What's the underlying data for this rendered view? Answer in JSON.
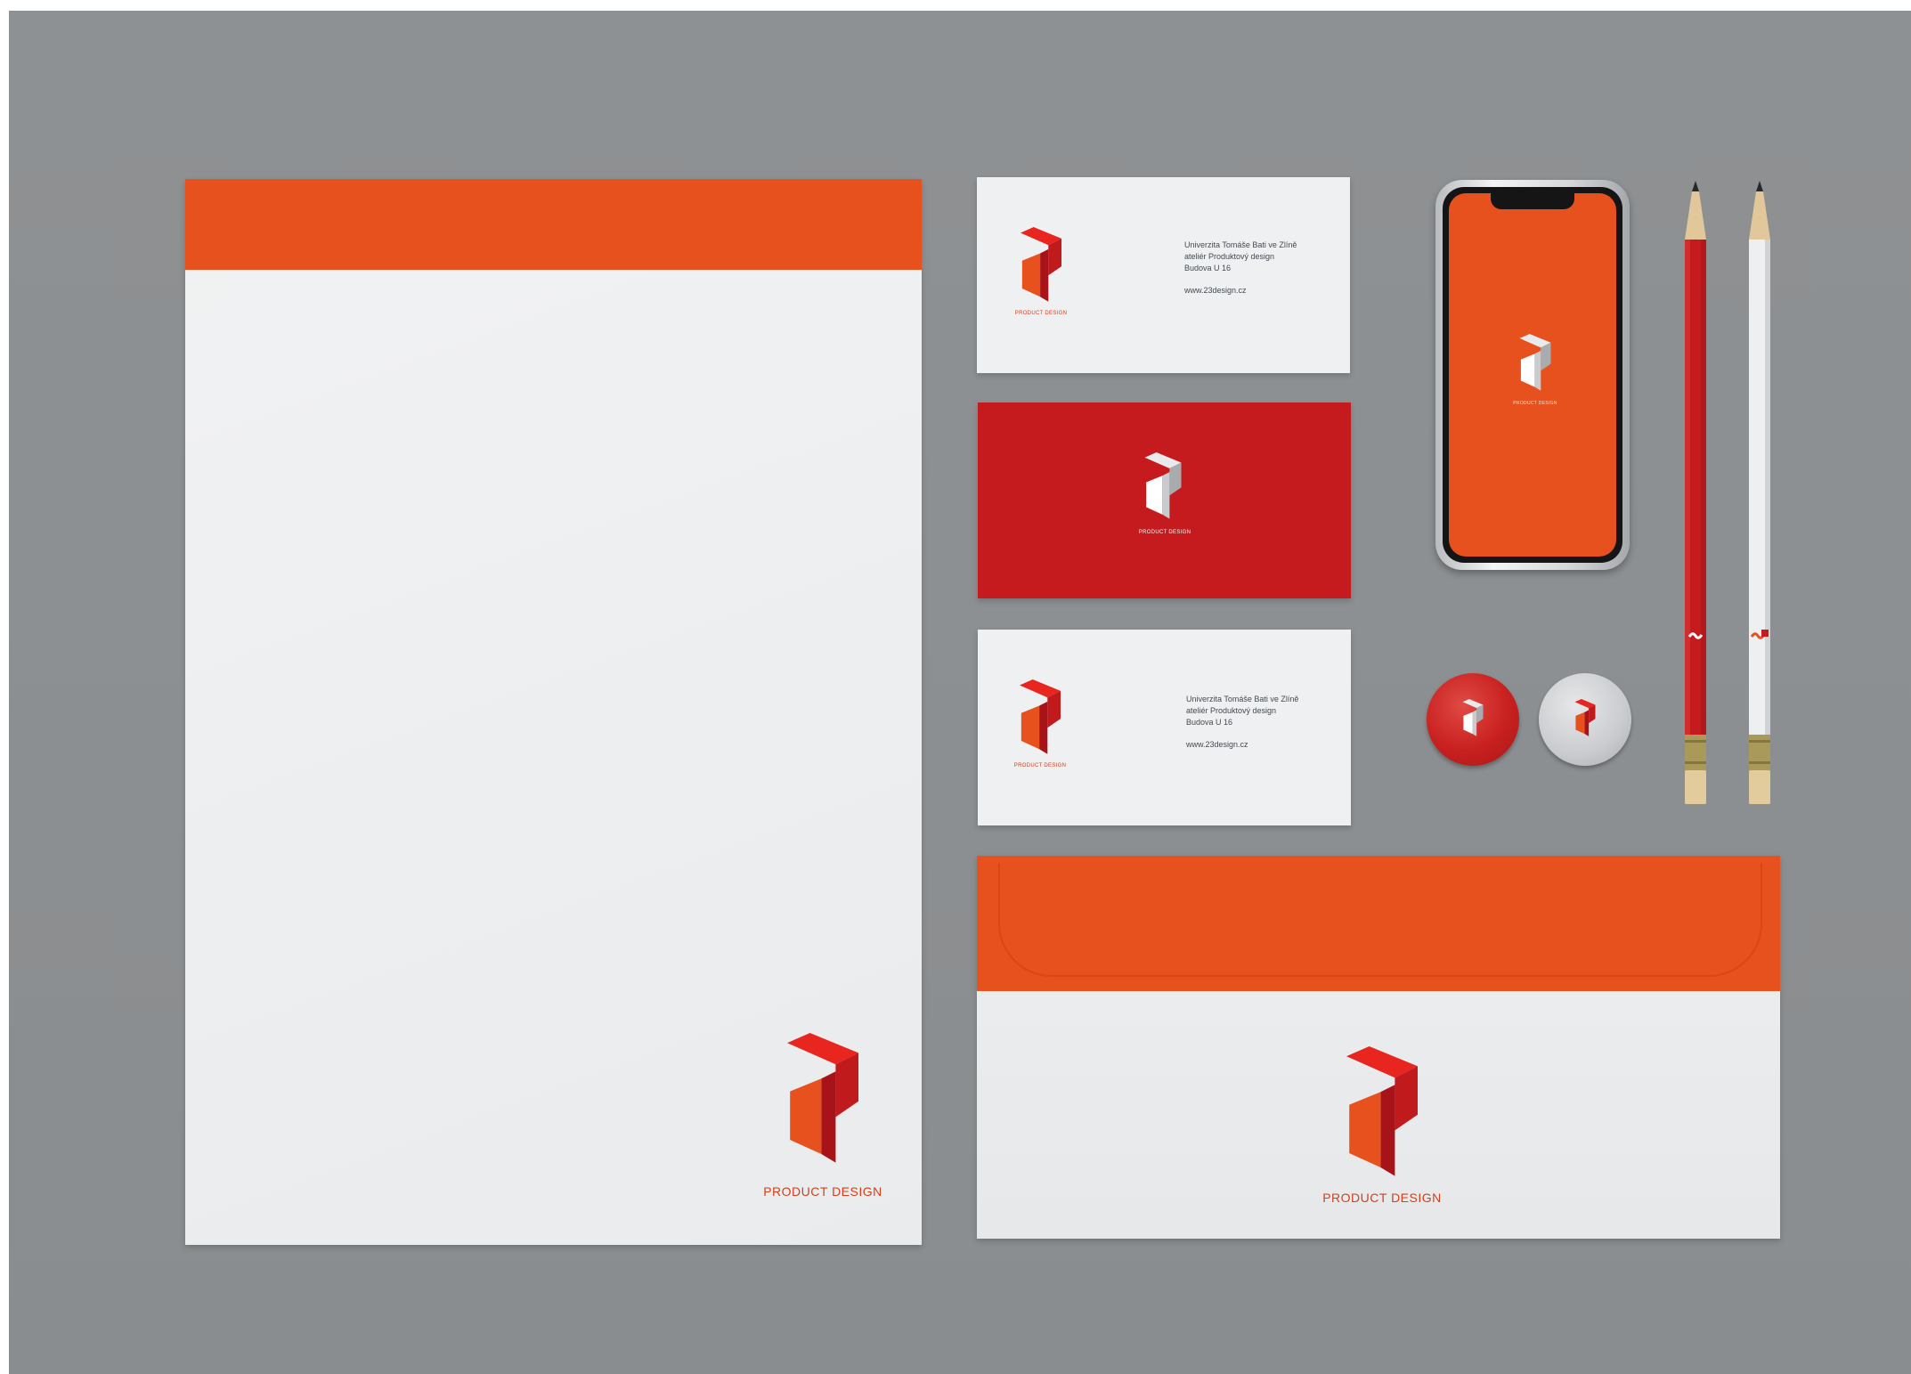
{
  "scene": {
    "description_label": "Product Design stationery mockup",
    "colors": {
      "background": "#8e9193",
      "brand_orange": "#e6511d",
      "brand_red": "#c61b1e",
      "paper": "#eef0f2"
    }
  },
  "letterhead": {
    "caption": "PRODUCT DESIGN",
    "icon": "product-design-logo-icon"
  },
  "card_front": {
    "caption": "PRODUCT DESIGN",
    "address_line_1": "Univerzita Tomáše Bati ve Zlíně",
    "address_line_2": "ateliér Produktový design",
    "address_line_3": "Budova U 16",
    "web": "www.23design.cz"
  },
  "card_red": {
    "caption": "PRODUCT DESIGN"
  },
  "card_back": {
    "caption": "PRODUCT DESIGN",
    "address_line_1": "Univerzita Tomáše Bati ve Zlíně",
    "address_line_2": "ateliér Produktový design",
    "address_line_3": "Budova U 16",
    "web": "www.23design.cz"
  },
  "phone": {
    "caption": "PRODUCT DESIGN"
  },
  "envelope": {
    "caption": "PRODUCT DESIGN"
  }
}
